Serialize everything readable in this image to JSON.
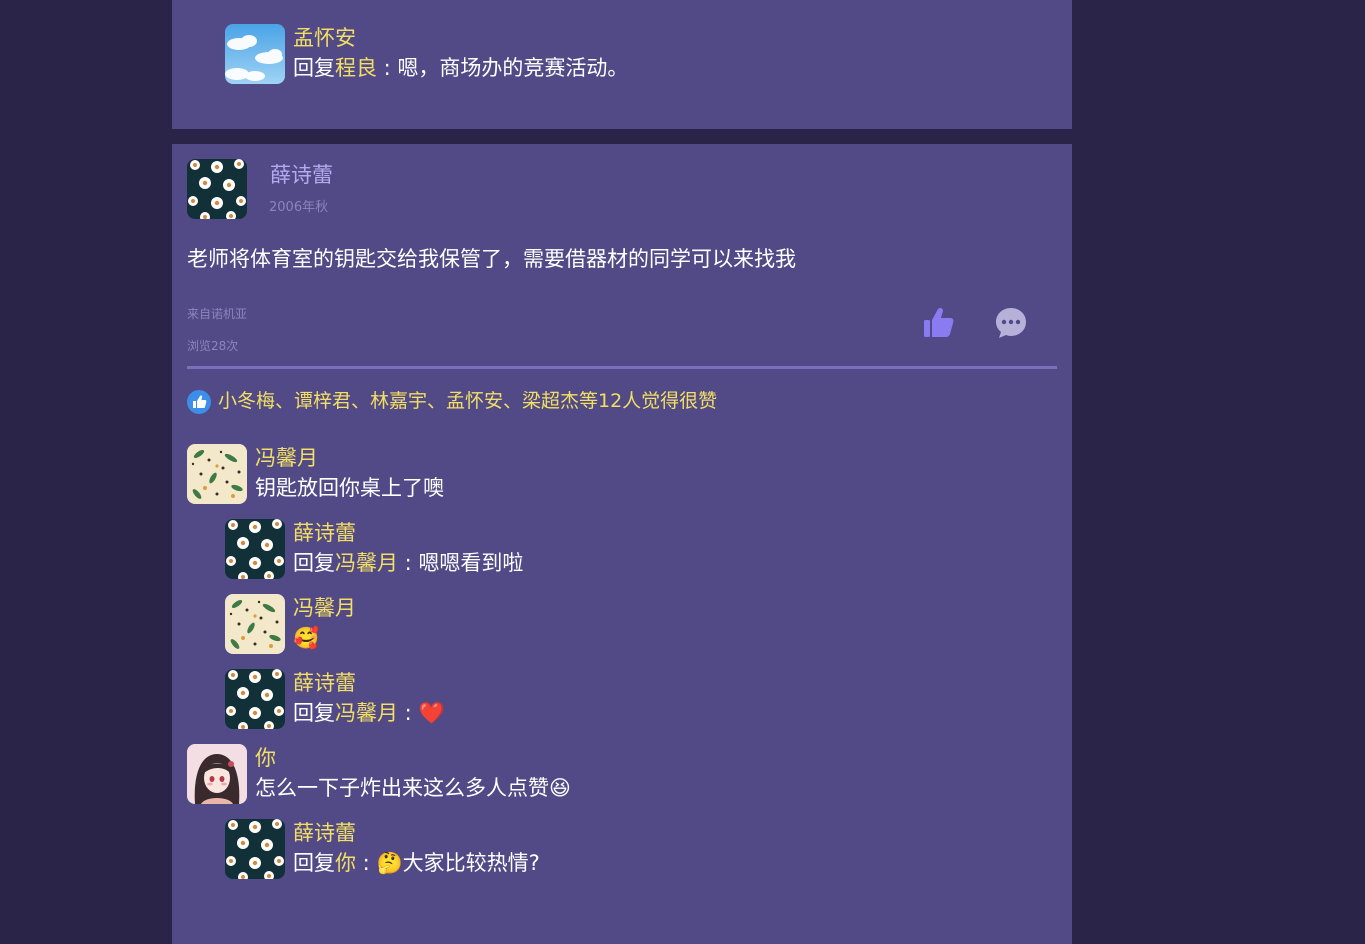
{
  "top_reply": {
    "name": "孟怀安",
    "prefix": "回复",
    "target": "程良",
    "separator": " : ",
    "text": "嗯，商场办的竞赛活动。"
  },
  "post": {
    "author": "薛诗蕾",
    "time": "2006年秋",
    "content": "老师将体育室的钥匙交给我保管了，需要借器材的同学可以来找我",
    "device": "来自诺机亚",
    "views": "浏览28次",
    "likes_text": "小冬梅、谭梓君、林嘉宇、孟怀安、梁超杰等12人觉得很赞"
  },
  "comments": [
    {
      "name": "冯馨月",
      "text": "钥匙放回你桌上了噢"
    },
    {
      "name": "薛诗蕾",
      "prefix": "回复",
      "target": "冯馨月",
      "separator": " : ",
      "text": "嗯嗯看到啦"
    },
    {
      "name": "冯馨月",
      "emoji": "🥰"
    },
    {
      "name": "薛诗蕾",
      "prefix": "回复",
      "target": "冯馨月",
      "separator": " : ",
      "emoji": "❤️"
    },
    {
      "name": "你",
      "text": "怎么一下子炸出来这么多人点赞",
      "emoji": "😆"
    },
    {
      "name": "薛诗蕾",
      "prefix": "回复",
      "target": "你",
      "separator": " : ",
      "emoji": "🤔",
      "text": "大家比较热情?"
    }
  ],
  "icons": {
    "like": "thumbs-up-icon",
    "comment": "comment-bubble-icon",
    "likes_badge": "like-badge-icon"
  },
  "colors": {
    "background": "#2a2548",
    "panel": "#514a86",
    "name_highlight": "#f2df63",
    "author_name": "#b5a9ef",
    "like_icon": "#8a7cf0",
    "comment_icon": "#b7b1d9"
  }
}
